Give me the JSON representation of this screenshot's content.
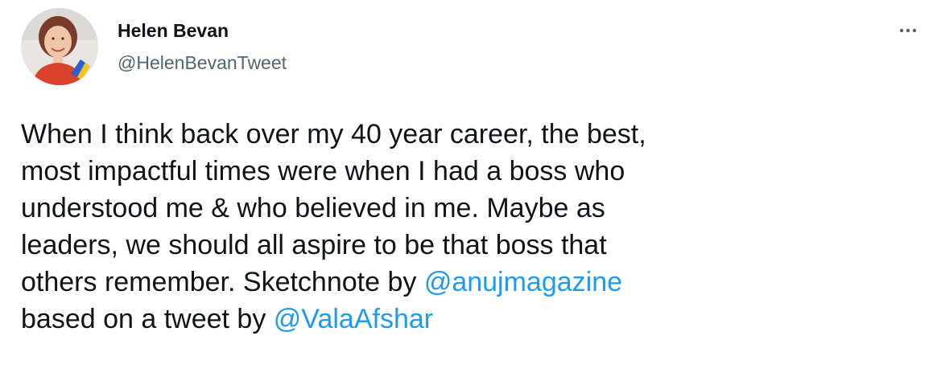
{
  "author": {
    "name": "Helen Bevan",
    "handle": "@HelenBevanTweet"
  },
  "tweet": {
    "text_part1": "When I think back over my 40 year career, the best,\nmost impactful times were when I had a boss who\nunderstood me & who believed in me. Maybe as\nleaders, we should all aspire to be that boss that\nothers remember. Sketchnote by ",
    "mention1": "@anujmagazine",
    "text_part2": "\nbased on a tweet by ",
    "mention2": "@ValaAfshar"
  },
  "icons": {
    "more": "more-horizontal-icon"
  },
  "colors": {
    "text": "#0f1419",
    "secondary_text": "#536471",
    "link": "#1d9bf0",
    "icon": "#536471"
  }
}
